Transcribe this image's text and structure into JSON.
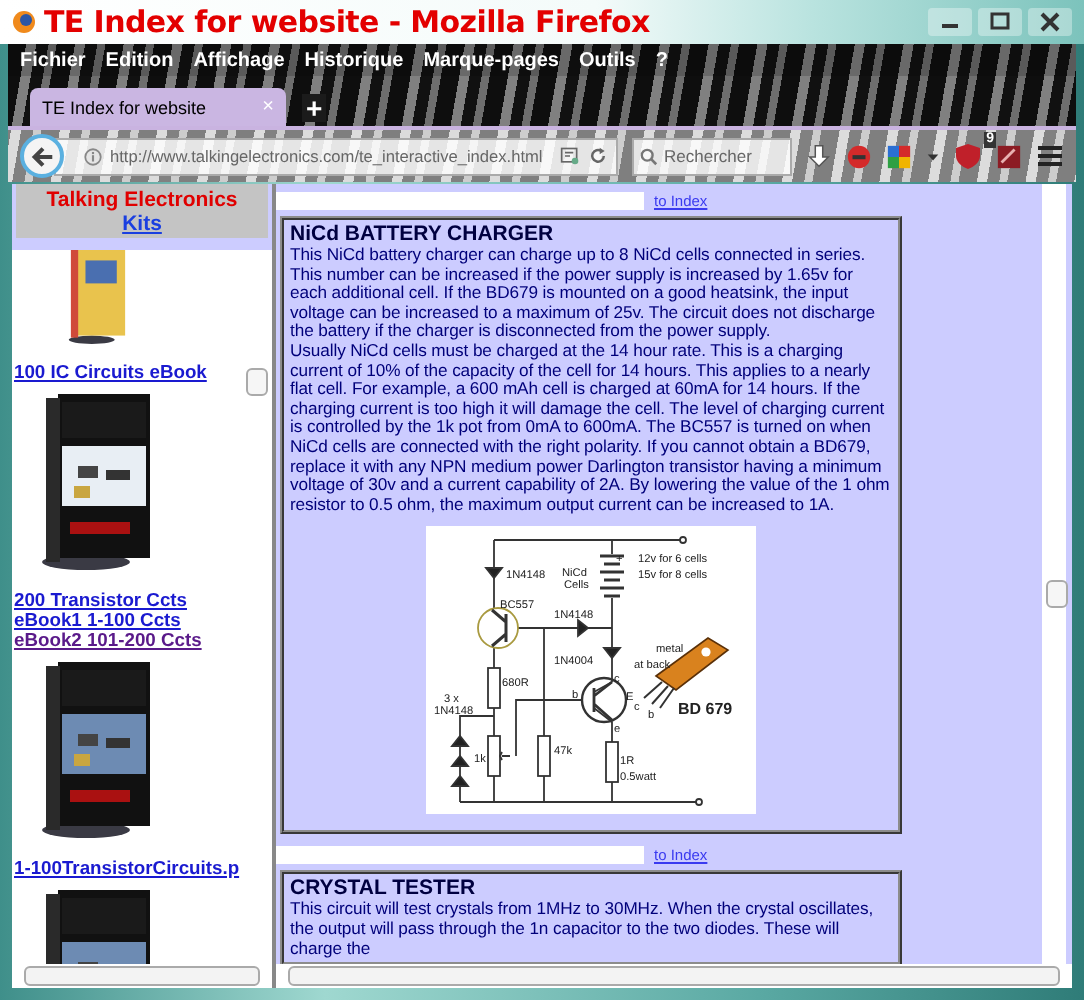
{
  "window": {
    "title": "TE Index for website - Mozilla Firefox"
  },
  "menu": [
    {
      "label": "Fichier"
    },
    {
      "label": "Edition"
    },
    {
      "label": "Affichage"
    },
    {
      "label": "Historique"
    },
    {
      "label": "Marque-pages"
    },
    {
      "label": "Outils"
    },
    {
      "label": "?"
    }
  ],
  "tabs": [
    {
      "label": "TE Index for website",
      "selected": true,
      "close": "×"
    }
  ],
  "new_tab": "+",
  "address_bar": {
    "value": "http://www.talkingelectronics.com/te_interactive_index.html"
  },
  "search": {
    "placeholder": "Rechercher"
  },
  "extension_badge": "9",
  "sidebar": {
    "heading": "Talking Electronics",
    "heading_link": "Kits",
    "items": [
      {
        "kind": "picture"
      },
      {
        "kind": "links",
        "lines": [
          {
            "text": "100 IC Circuits eBook",
            "visited": false
          }
        ]
      },
      {
        "kind": "picture"
      },
      {
        "kind": "links",
        "lines": [
          {
            "text": "200 Transistor Ccts",
            "visited": false
          },
          {
            "text": "eBook1   1-100 Ccts",
            "visited": false
          },
          {
            "text": "eBook2  101-200 Ccts",
            "visited": true
          }
        ]
      },
      {
        "kind": "picture"
      },
      {
        "kind": "links",
        "lines": [
          {
            "text": "1-100TransistorCircuits.p",
            "visited": false
          }
        ]
      },
      {
        "kind": "picture"
      }
    ]
  },
  "main": {
    "sections": [
      {
        "kind": "nav",
        "link": "to Index"
      },
      {
        "kind": "article",
        "title": "NiCd BATTERY CHARGER",
        "paragraphs": [
          "This NiCd battery charger can charge up to 8 NiCd cells connected in series. This number can be increased if the power supply is increased by 1.65v for each additional cell. If the BD679 is mounted on a good heatsink, the input voltage can be increased to a maximum of 25v. The circuit does not discharge the battery if the charger is disconnected from the power supply.",
          "Usually NiCd cells must be charged at the 14 hour rate. This is a charging current of 10% of the capacity of the cell for 14 hours. This applies to a nearly flat cell. For example, a 600 mAh cell is charged at 60mA for 14 hours. If the charging current is too high it will damage the cell. The level of charging current is controlled by the 1k pot from 0mA to 600mA. The BC557 is turned on when NiCd cells are connected with the right polarity. If you cannot obtain a BD679, replace it with any NPN medium power Darlington transistor having a minimum voltage of 30v and a current capability of 2A. By lowering the value of the 1 ohm resistor to 0.5 ohm, the maximum output current can be increased to 1A."
        ],
        "diagram": {
          "labels": [
            "1N4148",
            "NiCd",
            "Cells",
            "+",
            "12v for 6 cells",
            "15v for 8 cells",
            "BC557",
            "1N4148",
            "1N4004",
            "metal",
            "at back",
            "680R",
            "3 x",
            "1N4148",
            "b",
            "c",
            "E",
            "e",
            "c",
            "b",
            "BD 679",
            "1k",
            "47k",
            "1R",
            "0.5watt"
          ]
        }
      },
      {
        "kind": "nav",
        "link": "to Index"
      },
      {
        "kind": "article",
        "title": "CRYSTAL TESTER",
        "paragraphs": [
          "This circuit will test crystals from 1MHz to 30MHz.  When the crystal oscillates, the output will pass through the 1n capacitor to the two diodes. These will charge the"
        ]
      }
    ]
  }
}
